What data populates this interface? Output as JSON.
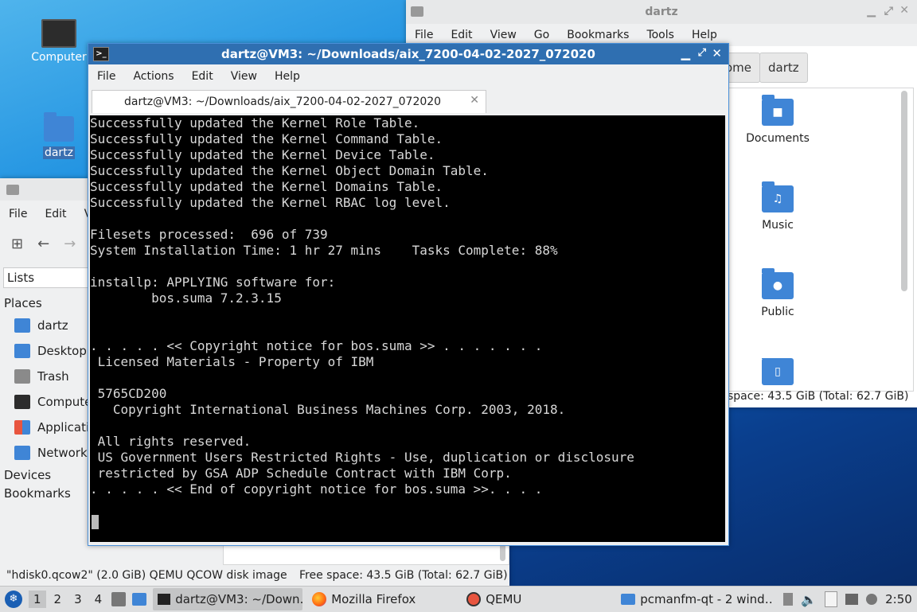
{
  "desktop": {
    "computer_label": "Computer",
    "home_label": "dartz"
  },
  "fm_right": {
    "title": "dartz",
    "menu": [
      "File",
      "Edit",
      "View",
      "Go",
      "Bookmarks",
      "Tools",
      "Help"
    ],
    "crumbs": [
      "ome",
      "dartz"
    ],
    "items": [
      {
        "label": "Documents",
        "glyph": "■"
      },
      {
        "label": "Music",
        "glyph": "♫"
      },
      {
        "label": "Public",
        "glyph": "●"
      },
      {
        "label": "",
        "glyph": "▯"
      }
    ],
    "status": "space: 43.5 GiB (Total: 62.7 GiB)"
  },
  "fm_left": {
    "menu": [
      "File",
      "Edit",
      "V"
    ],
    "lists_label": "Lists",
    "places_header": "Places",
    "places": [
      {
        "label": "dartz",
        "icon": "home-folder-icon",
        "color": "#3f85d6"
      },
      {
        "label": "Desktop",
        "icon": "desktop-icon",
        "color": "#3f85d6"
      },
      {
        "label": "Trash",
        "icon": "trash-icon",
        "color": "#8a8a8a"
      },
      {
        "label": "Compute",
        "icon": "computer-icon",
        "color": "#2c2c2c"
      },
      {
        "label": "Applicatio",
        "icon": "applications-icon",
        "color": "#e8553f"
      },
      {
        "label": "Network",
        "icon": "network-icon",
        "color": "#3f85d6"
      }
    ],
    "devices_header": "Devices",
    "bookmarks_header": "Bookmarks",
    "status_file": "\"hdisk0.qcow2\" (2.0 GiB) QEMU QCOW disk image",
    "status_free": "Free space: 43.5 GiB (Total: 62.7 GiB)"
  },
  "terminal": {
    "title": "dartz@VM3: ~/Downloads/aix_7200-04-02-2027_072020",
    "menu": [
      "File",
      "Actions",
      "Edit",
      "View",
      "Help"
    ],
    "tab_label": "dartz@VM3: ~/Downloads/aix_7200-04-02-2027_072020",
    "lines": [
      "Successfully updated the Kernel Role Table.",
      "Successfully updated the Kernel Command Table.",
      "Successfully updated the Kernel Device Table.",
      "Successfully updated the Kernel Object Domain Table.",
      "Successfully updated the Kernel Domains Table.",
      "Successfully updated the Kernel RBAC log level.",
      "",
      "Filesets processed:  696 of 739",
      "System Installation Time: 1 hr 27 mins    Tasks Complete: 88%",
      "",
      "installp: APPLYING software for:",
      "        bos.suma 7.2.3.15",
      "",
      "",
      ". . . . . << Copyright notice for bos.suma >> . . . . . . .",
      " Licensed Materials - Property of IBM",
      "",
      " 5765CD200",
      "   Copyright International Business Machines Corp. 2003, 2018.",
      "",
      " All rights reserved.",
      " US Government Users Restricted Rights - Use, duplication or disclosure",
      " restricted by GSA ADP Schedule Contract with IBM Corp.",
      ". . . . . << End of copyright notice for bos.suma >>. . . .",
      "",
      ""
    ]
  },
  "taskbar": {
    "workspaces": [
      "1",
      "2",
      "3",
      "4"
    ],
    "tasks": [
      {
        "label": "dartz@VM3: ~/Down…",
        "icon": "terminal-icon"
      },
      {
        "label": "Mozilla Firefox",
        "icon": "firefox-icon"
      },
      {
        "label": "QEMU",
        "icon": "qemu-icon"
      },
      {
        "label": "pcmanfm-qt - 2 wind…",
        "icon": "folder-icon"
      }
    ],
    "clock": "2:50"
  }
}
